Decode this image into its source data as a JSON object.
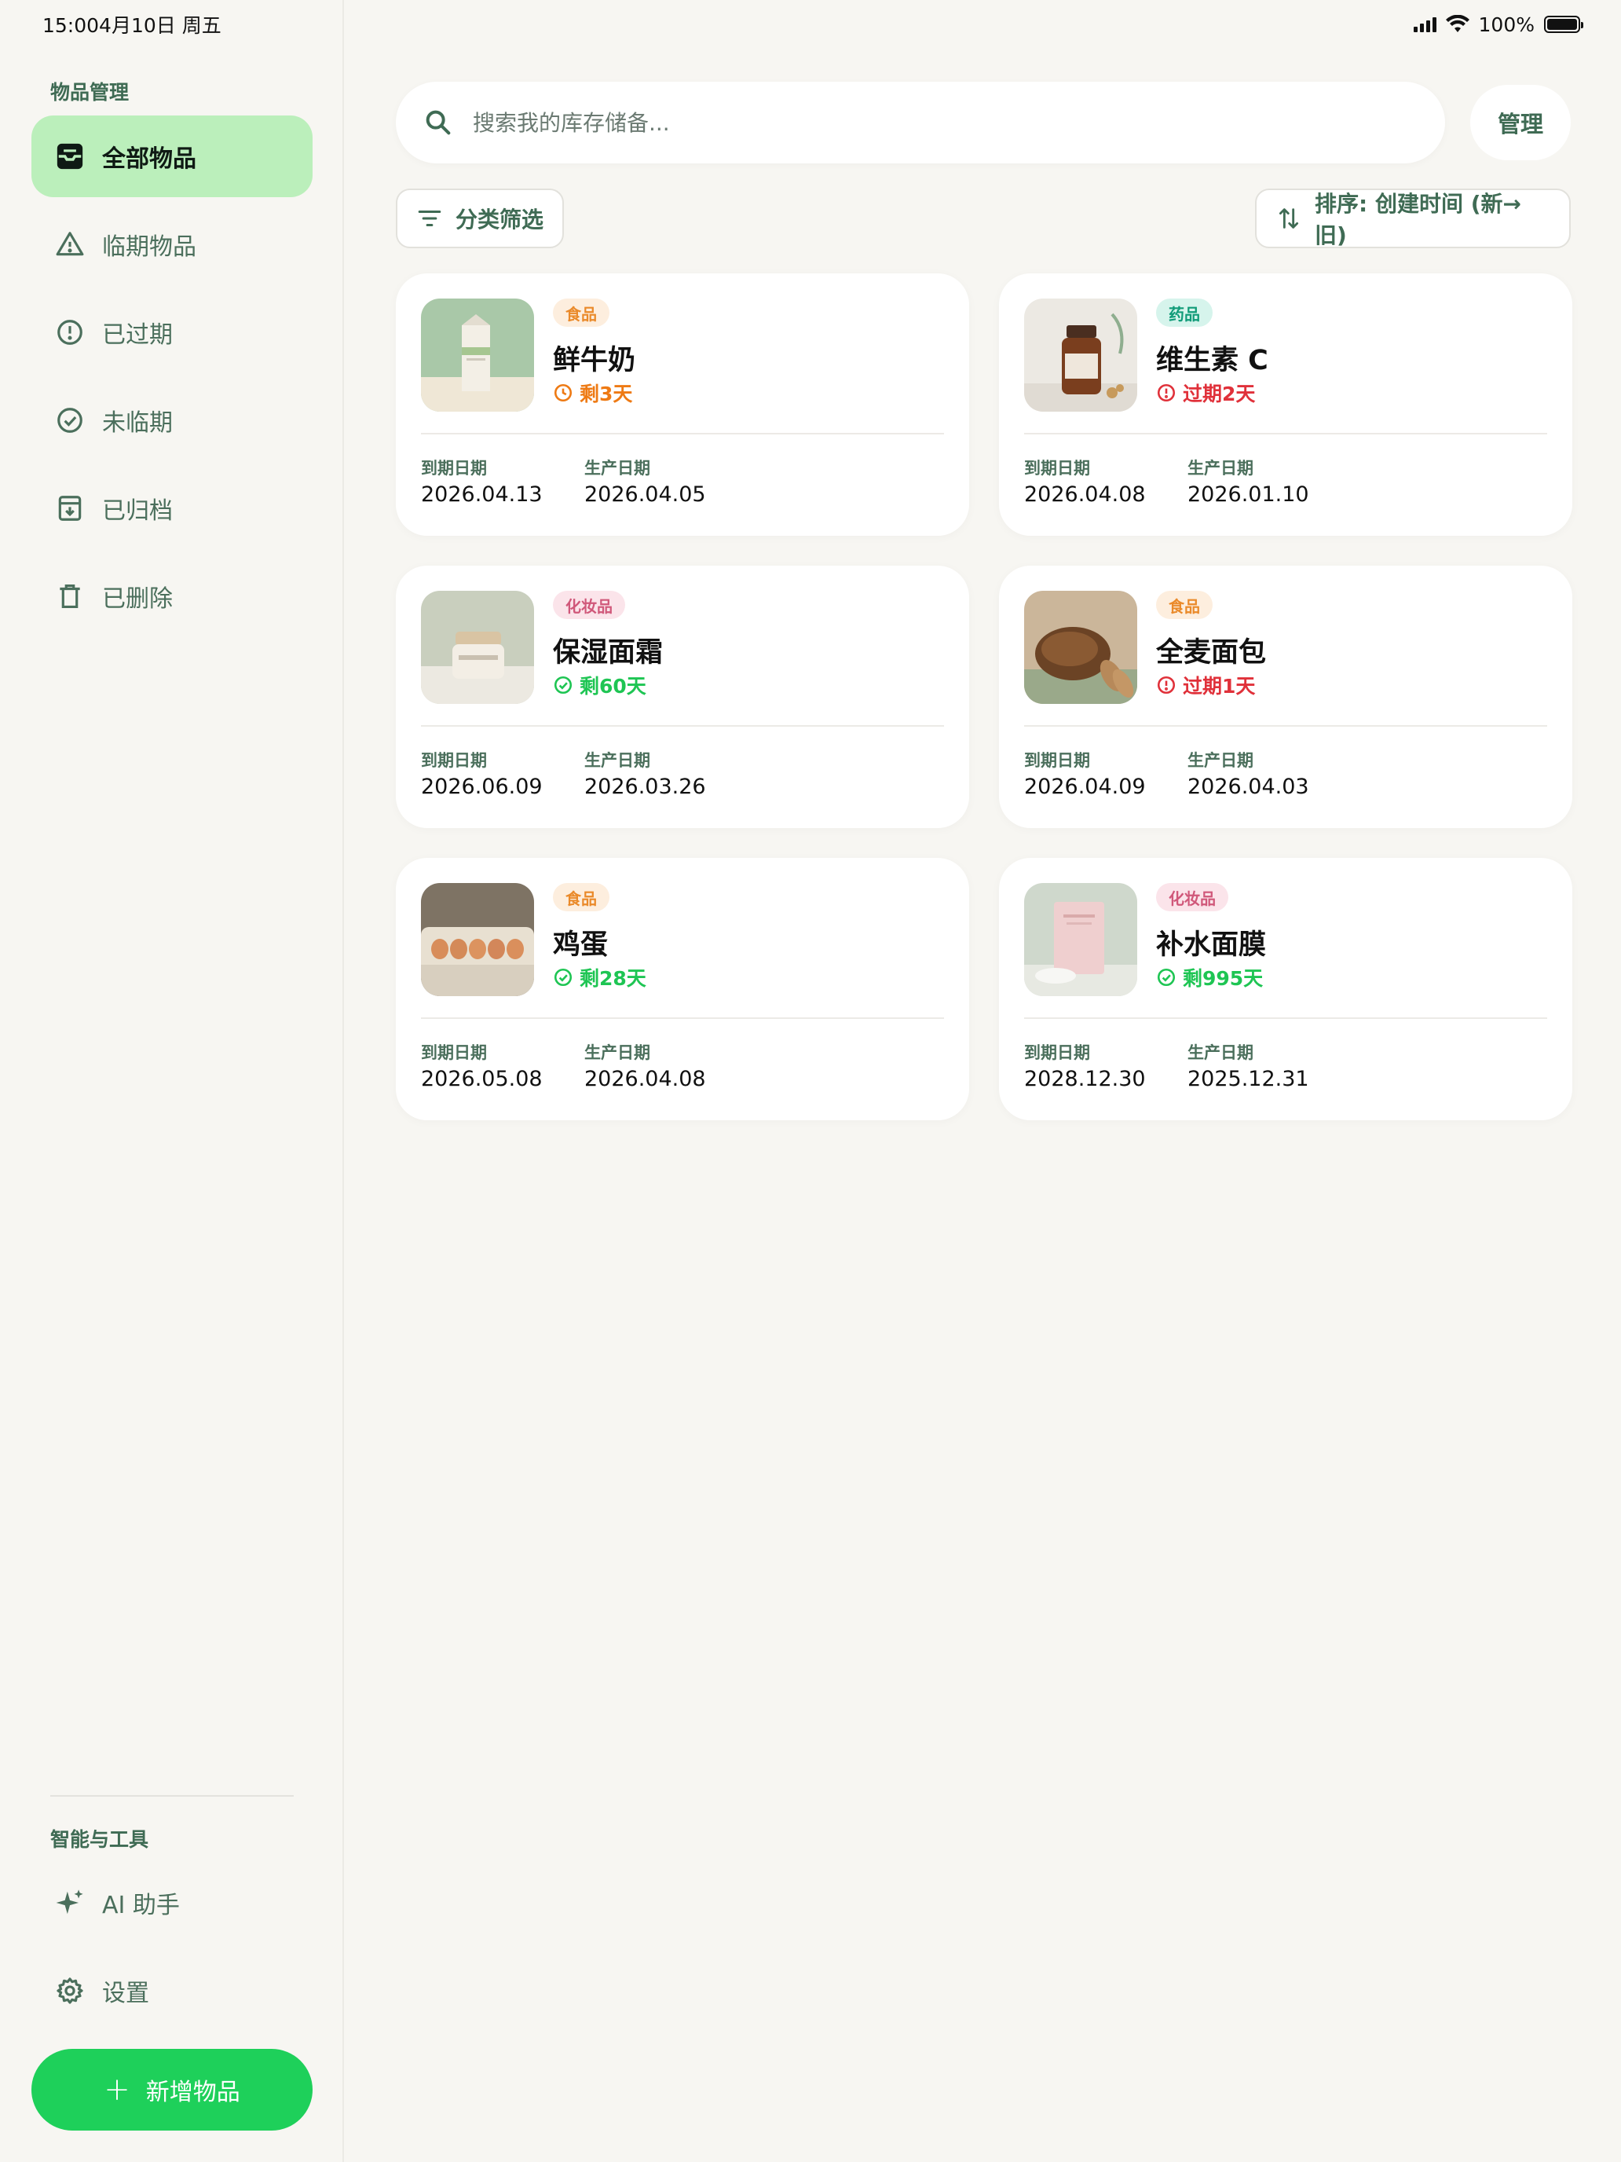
{
  "status_bar": {
    "time": "15:00",
    "date": "4月10日 周五",
    "battery": "100%"
  },
  "sidebar": {
    "section1_label": "物品管理",
    "items": [
      {
        "label": "全部物品",
        "icon": "inbox-icon"
      },
      {
        "label": "临期物品",
        "icon": "warning-triangle-icon"
      },
      {
        "label": "已过期",
        "icon": "alert-circle-icon"
      },
      {
        "label": "未临期",
        "icon": "check-circle-icon"
      },
      {
        "label": "已归档",
        "icon": "archive-icon"
      },
      {
        "label": "已删除",
        "icon": "trash-icon"
      }
    ],
    "section2_label": "智能与工具",
    "tools": [
      {
        "label": "AI 助手",
        "icon": "sparkle-icon"
      },
      {
        "label": "设置",
        "icon": "gear-icon"
      }
    ],
    "add_button": "新增物品"
  },
  "toolbar": {
    "search_placeholder": "搜索我的库存储备...",
    "manage": "管理",
    "filter": "分类筛选",
    "sort": "排序: 创建时间 (新→旧)"
  },
  "labels": {
    "expiry": "到期日期",
    "production": "生产日期"
  },
  "items": [
    {
      "tag": "食品",
      "name": "鲜牛奶",
      "remain": "剩3天",
      "expiry": "2026.04.13",
      "production": "2026.04.05"
    },
    {
      "tag": "药品",
      "name": "维生素 C",
      "remain": "过期2天",
      "expiry": "2026.04.08",
      "production": "2026.01.10"
    },
    {
      "tag": "化妆品",
      "name": "保湿面霜",
      "remain": "剩60天",
      "expiry": "2026.06.09",
      "production": "2026.03.26"
    },
    {
      "tag": "食品",
      "name": "全麦面包",
      "remain": "过期1天",
      "expiry": "2026.04.09",
      "production": "2026.04.03"
    },
    {
      "tag": "食品",
      "name": "鸡蛋",
      "remain": "剩28天",
      "expiry": "2026.05.08",
      "production": "2026.04.08"
    },
    {
      "tag": "化妆品",
      "name": "补水面膜",
      "remain": "剩995天",
      "expiry": "2028.12.30",
      "production": "2025.12.31"
    }
  ],
  "colors": {
    "accent": "#1ed05a",
    "active_nav": "#bbefbb",
    "warn": "#ee7a14",
    "expired": "#e0313a",
    "ok": "#1ec553"
  }
}
